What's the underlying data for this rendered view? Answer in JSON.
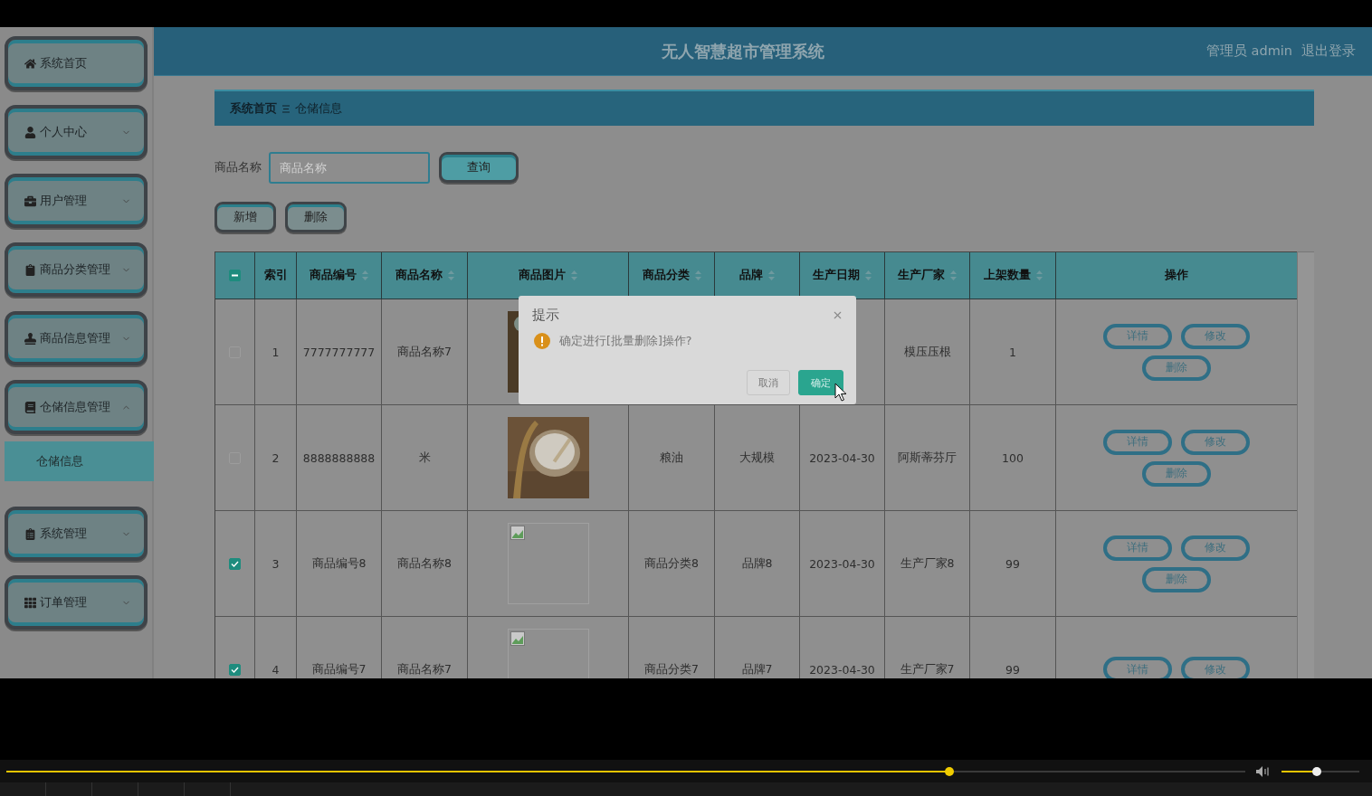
{
  "header": {
    "title": "无人智慧超市管理系统",
    "user": "管理员 admin",
    "logout": "退出登录"
  },
  "sidebar": {
    "items": [
      {
        "label": "系统首页",
        "kind": "link"
      },
      {
        "label": "个人中心",
        "kind": "menu",
        "expanded": false
      },
      {
        "label": "用户管理",
        "kind": "menu",
        "expanded": false
      },
      {
        "label": "商品分类管理",
        "kind": "menu",
        "expanded": false
      },
      {
        "label": "商品信息管理",
        "kind": "menu",
        "expanded": false
      },
      {
        "label": "仓储信息管理",
        "kind": "menu",
        "expanded": true,
        "children": [
          {
            "label": "仓储信息",
            "selected": true
          }
        ]
      },
      {
        "label": "系统管理",
        "kind": "menu",
        "expanded": false
      },
      {
        "label": "订单管理",
        "kind": "menu",
        "expanded": false
      }
    ]
  },
  "breadcrumb": [
    "系统首页",
    "仓储信息"
  ],
  "search": {
    "label": "商品名称",
    "placeholder": "商品名称",
    "button": "查询"
  },
  "actions": [
    "新增",
    "删除"
  ],
  "table": {
    "select_all": {
      "indeterminate": true
    },
    "columns": [
      {
        "label": "索引",
        "sortable": false
      },
      {
        "label": "商品编号",
        "sortable": true
      },
      {
        "label": "商品名称",
        "sortable": true
      },
      {
        "label": "商品图片",
        "sortable": true
      },
      {
        "label": "商品分类",
        "sortable": true
      },
      {
        "label": "品牌",
        "sortable": true
      },
      {
        "label": "生产日期",
        "sortable": true
      },
      {
        "label": "生产厂家",
        "sortable": true
      },
      {
        "label": "上架数量",
        "sortable": true
      },
      {
        "label": "操作",
        "sortable": false
      }
    ],
    "rows": [
      {
        "checked": false,
        "index": "1",
        "code": "7777777777",
        "name": "商品名称7",
        "image": {
          "kind": "picture"
        },
        "maker": "模压压根",
        "qty": "1",
        "buttons": [
          "详情",
          "修改",
          "删除"
        ]
      },
      {
        "checked": false,
        "index": "2",
        "code": "8888888888",
        "name": "米",
        "image": {
          "kind": "picture"
        },
        "category": "粮油",
        "brand": "大规模",
        "date": "2023-04-30",
        "maker": "阿斯蒂芬厅",
        "qty": "100",
        "buttons": [
          "详情",
          "修改",
          "删除"
        ]
      },
      {
        "checked": true,
        "index": "3",
        "code": "商品编号8",
        "name": "商品名称8",
        "image": {
          "kind": "broken"
        },
        "category": "商品分类8",
        "brand": "品牌8",
        "date": "2023-04-30",
        "maker": "生产厂家8",
        "qty": "99",
        "buttons": [
          "详情",
          "修改",
          "删除"
        ]
      },
      {
        "checked": true,
        "index": "4",
        "code": "商品编号7",
        "name": "商品名称7",
        "image": {
          "kind": "broken"
        },
        "category": "商品分类7",
        "brand": "品牌7",
        "date": "2023-04-30",
        "maker": "生产厂家7",
        "qty": "99",
        "buttons": [
          "详情",
          "修改"
        ]
      }
    ]
  },
  "dialog": {
    "title": "提示",
    "message": "确定进行[批量删除]操作?",
    "buttons": [
      {
        "label": "取消",
        "primary": false
      },
      {
        "label": "确定",
        "primary": true
      }
    ]
  },
  "player": {
    "progress": {
      "level": 0.761
    },
    "volume": {
      "level": 0.45
    }
  }
}
